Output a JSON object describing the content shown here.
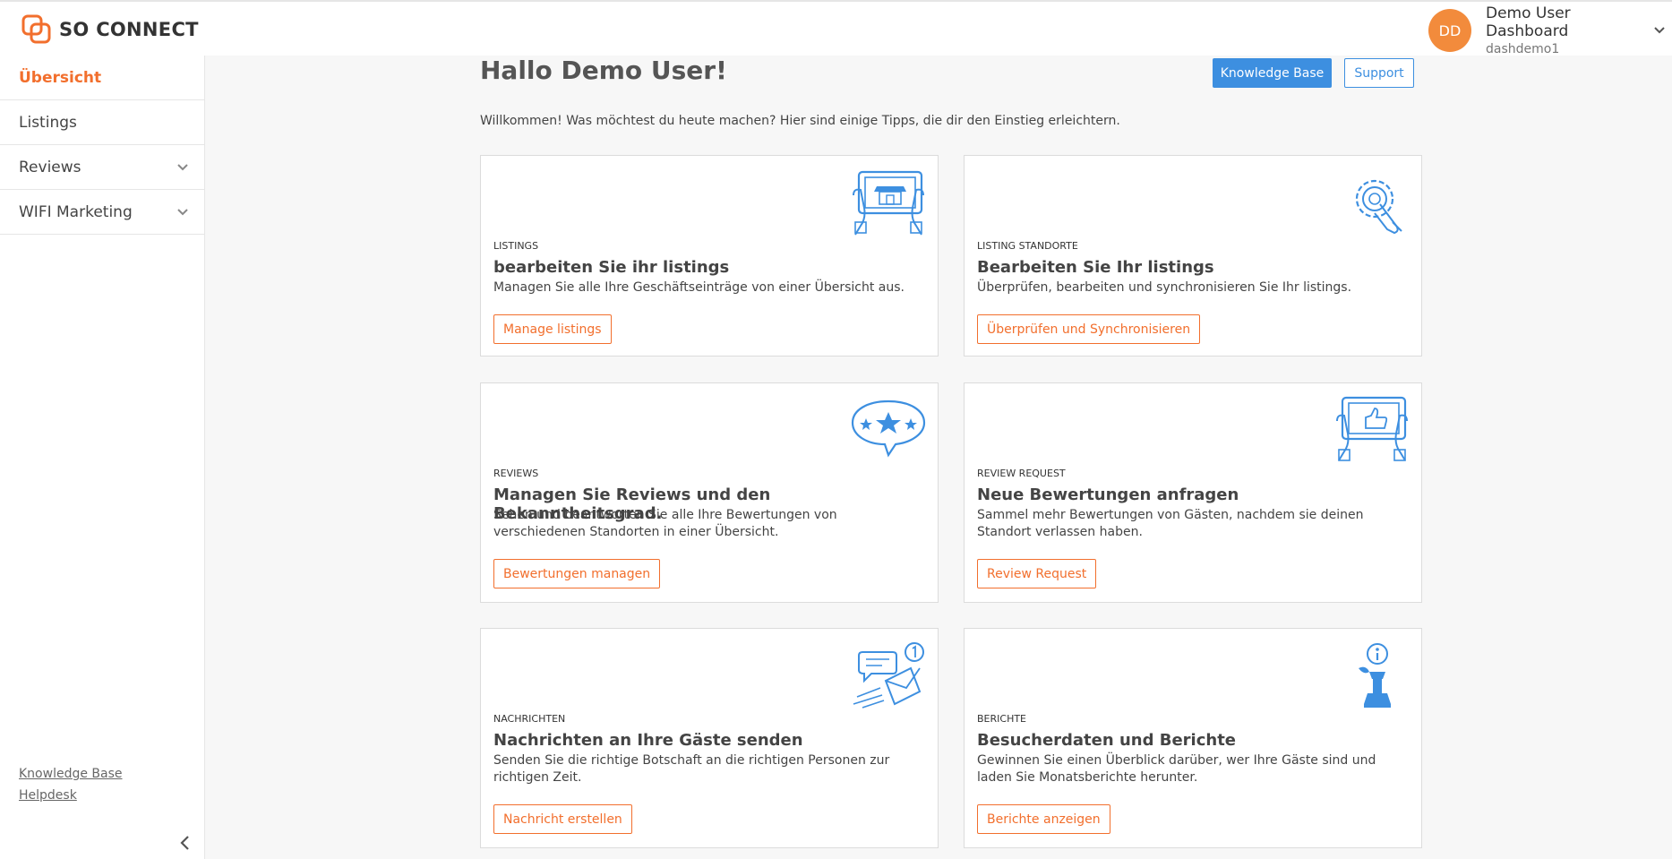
{
  "brand": {
    "name": "SO CONNECT",
    "accent": "#f26f2d"
  },
  "user": {
    "initials": "DD",
    "name": "Demo User Dashboard",
    "username": "dashdemo1"
  },
  "sidebar": {
    "items": [
      {
        "label": "Übersicht",
        "active": true
      },
      {
        "label": "Listings"
      },
      {
        "label": "Reviews",
        "expandable": true
      },
      {
        "label": "WIFI Marketing",
        "expandable": true
      }
    ],
    "links": {
      "knowledge_base": "Knowledge Base",
      "helpdesk": "Helpdesk"
    }
  },
  "main": {
    "title": "Hallo Demo User!",
    "knowledge_base_btn": "Knowledge Base",
    "support_btn": "Support",
    "welcome": "Willkommen! Was möchtest du heute machen? Hier sind einige Tipps, die dir den Einstieg erleichtern.",
    "cards": [
      {
        "category": "Listings",
        "title": "bearbeiten Sie ihr listings",
        "description": "Managen Sie alle Ihre Geschäftseinträge von einer Übersicht aus.",
        "button": "Manage listings",
        "icon": "tablet-store-icon"
      },
      {
        "category": "Listing Standorte",
        "title": "Bearbeiten Sie Ihr listings",
        "description": "Überprüfen, bearbeiten und synchronisieren Sie Ihr listings.",
        "button": "Überprüfen und Synchronisieren",
        "icon": "gear-hand-icon"
      },
      {
        "category": "Reviews",
        "title": "Managen Sie Reviews und den Bekanntheitsgrad.",
        "description": "Sehen und beantworten Sie alle Ihre Bewertungen von verschiedenen Standorten in einer Übersicht.",
        "button": "Bewertungen managen",
        "icon": "star-bubble-icon"
      },
      {
        "category": "Review Request",
        "title": "Neue Bewertungen anfragen",
        "description": "Sammel mehr Bewertungen von Gästen, nachdem sie deinen Standort verlassen haben.",
        "button": "Review Request",
        "icon": "tablet-thumbs-up-icon"
      },
      {
        "category": "Nachrichten",
        "title": "Nachrichten an Ihre Gäste senden",
        "description": "Senden Sie die richtige Botschaft an die richtigen Personen zur richtigen Zeit.",
        "button": "Nachricht erstellen",
        "icon": "envelope-message-icon"
      },
      {
        "category": "Berichte",
        "title": "Besucherdaten und Berichte",
        "description": "Gewinnen Sie einen Überblick darüber, wer Ihre Gäste sind und laden Sie Monatsberichte herunter.",
        "button": "Berichte anzeigen",
        "icon": "chess-info-icon"
      }
    ]
  },
  "colors": {
    "primary_blue": "#3d8fe0",
    "icon_blue": "#3d8fe0",
    "avatar": "#f28b3c"
  }
}
